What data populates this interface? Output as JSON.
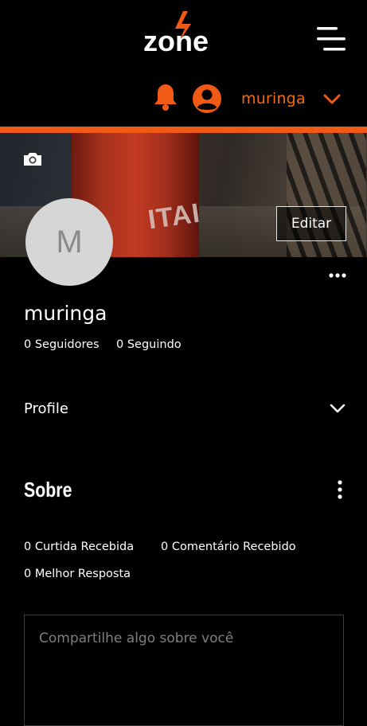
{
  "header": {
    "logo_text": "zone",
    "menu_icon": "hamburger-icon",
    "bell_icon": "bell-icon",
    "user_icon": "user-circle-icon",
    "username": "muringa",
    "chevron_icon": "chevron-down-icon",
    "accent_color": "#f05a14"
  },
  "cover": {
    "camera_icon": "camera-icon",
    "cup_text": "ITAI",
    "edit_label": "Editar"
  },
  "profile": {
    "avatar_initial": "M",
    "name": "muringa",
    "followers": "0 Seguidores",
    "following": "0 Seguindo",
    "more_icon": "more-horizontal-icon"
  },
  "profile_dropdown": {
    "label": "Profile",
    "chevron_icon": "chevron-down-icon"
  },
  "about": {
    "title": "Sobre",
    "more_icon": "more-vertical-icon",
    "likes": "0 Curtida Recebida",
    "comments": "0 Comentário Recebido",
    "best_answers": "0 Melhor Resposta",
    "share_placeholder": "Compartilhe algo sobre você"
  }
}
